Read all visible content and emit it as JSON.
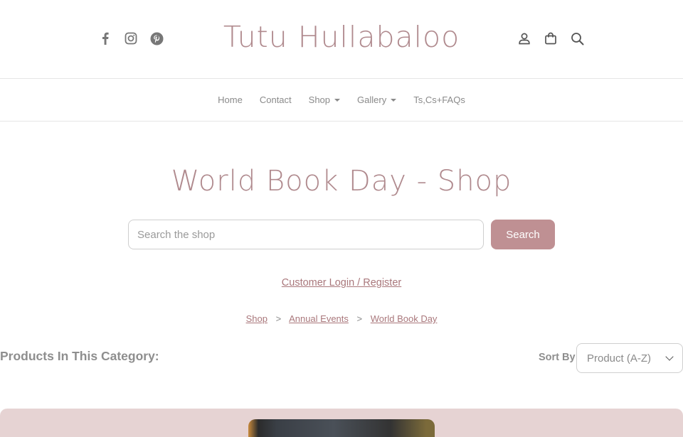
{
  "header": {
    "brand": "Tutu Hullabaloo",
    "social_icons": [
      "facebook-icon",
      "instagram-icon",
      "pinterest-icon"
    ],
    "tool_icons": [
      "user-icon",
      "shopping-bag-icon",
      "search-icon"
    ]
  },
  "nav": {
    "items": [
      {
        "label": "Home",
        "dropdown": false
      },
      {
        "label": "Contact",
        "dropdown": false
      },
      {
        "label": "Shop",
        "dropdown": true
      },
      {
        "label": "Gallery",
        "dropdown": true
      },
      {
        "label": "Ts,Cs+FAQs",
        "dropdown": false
      }
    ]
  },
  "page": {
    "title": "World Book Day - Shop",
    "search": {
      "placeholder": "Search the shop",
      "value": "",
      "button": "Search"
    },
    "login_link": "Customer Login / Register",
    "breadcrumb": [
      "Shop",
      "Annual Events",
      "World Book Day"
    ],
    "breadcrumb_sep": ">",
    "products_heading": "Products In This Category:",
    "sort": {
      "label": "Sort By",
      "selected": "Product (A-Z)"
    }
  },
  "colors": {
    "accent": "#b08a8e",
    "button": "#bf9093",
    "link": "#a9777b",
    "product_bg": "#e6d3d3"
  }
}
